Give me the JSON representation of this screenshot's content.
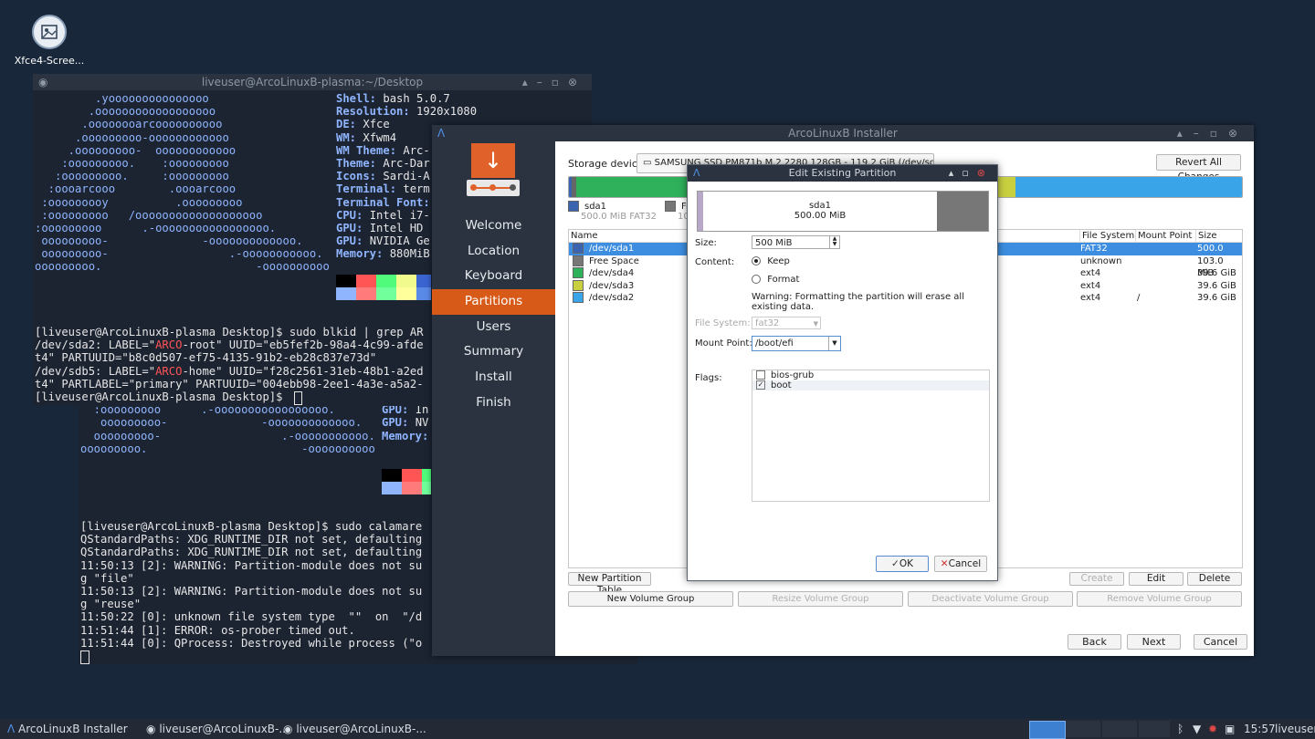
{
  "desktop": {
    "icon_label": "Xfce4-Scree..."
  },
  "terminal_front": {
    "title": "liveuser@ArcoLinuxB-plasma:~/Desktop",
    "logo": [
      "         .yooooooooooooooo",
      "        .oooooooooooooooooo",
      "       .oooooooarcoooooooooo",
      "      .ooooooooo-oooooooooooo",
      "     .ooooooooo-  oooooooooooo",
      "    :ooooooooo.    :ooooooooo",
      "   :ooooooooo.     :ooooooooo",
      "  :oooarcooo        .oooarcooo",
      " :ooooooooy          .ooooooooo",
      " :ooooooooo   /ooooooooooooooooooo",
      ":ooooooooo      .-ooooooooooooooooo.",
      " ooooooooo-              -ooooooooooooo.",
      " ooooooooo-                  .-ooooooooooo.",
      "ooooooooo.                       -oooooooooo"
    ],
    "info": [
      {
        "k": "Shell:",
        "v": " bash 5.0.7"
      },
      {
        "k": "Resolution:",
        "v": " 1920x1080"
      },
      {
        "k": "DE:",
        "v": " Xfce"
      },
      {
        "k": "WM:",
        "v": " Xfwm4"
      },
      {
        "k": "WM Theme:",
        "v": " Arc-"
      },
      {
        "k": "Theme:",
        "v": " Arc-Dar"
      },
      {
        "k": "Icons:",
        "v": " Sardi-A"
      },
      {
        "k": "Terminal:",
        "v": " term"
      },
      {
        "k": "Terminal Font:",
        "v": ""
      },
      {
        "k": "CPU:",
        "v": " Intel i7-"
      },
      {
        "k": "GPU:",
        "v": " Intel HD"
      },
      {
        "k": "GPU:",
        "v": " NVIDIA Ge"
      },
      {
        "k": "Memory:",
        "v": " 880MiB"
      }
    ],
    "cmd_lines": [
      "[liveuser@ArcoLinuxB-plasma Desktop]$ sudo blkid | grep AR",
      "/dev/sda2: LABEL=\"ARCO-root\" UUID=\"eb5fef2b-98a4-4c99-afde",
      "t4\" PARTUUID=\"b8c0d507-ef75-4135-91b2-eb28c837e73d\"",
      "/dev/sdb5: LABEL=\"ARCO-home\" UUID=\"f28c2561-31eb-48b1-a2ed",
      "t4\" PARTLABEL=\"primary\" PARTUUID=\"004ebb98-2ee1-4a3e-a5a2-",
      "[liveuser@ArcoLinuxB-plasma Desktop]$ "
    ]
  },
  "terminal_back": {
    "logo": [
      "   :ooooooooo   /ooooooooooooooooooo",
      "  :ooooooooo      .-ooooooooooooooooo.",
      "   ooooooooo-              -ooooooooooooo.",
      "  ooooooooo-                  .-ooooooooooo.",
      "ooooooooo.                       -oooooooooo"
    ],
    "info": [
      {
        "k": "CPU:",
        "v": " In"
      },
      {
        "k": "GPU:",
        "v": " In"
      },
      {
        "k": "GPU:",
        "v": " NV"
      },
      {
        "k": "Memory:",
        "v": ""
      }
    ],
    "cmd_lines": [
      "[liveuser@ArcoLinuxB-plasma Desktop]$ sudo calamare",
      "QStandardPaths: XDG_RUNTIME_DIR not set, defaulting",
      "QStandardPaths: XDG_RUNTIME_DIR not set, defaulting",
      "11:50:13 [2]: WARNING: Partition-module does not su",
      "g \"file\"",
      "11:50:13 [2]: WARNING: Partition-module does not su",
      "g \"reuse\"",
      "11:50:22 [0]: unknown file system type  \"\"  on  \"/d",
      "11:51:44 [1]: ERROR: os-prober timed out.",
      "11:51:44 [0]: QProcess: Destroyed while process (\"o"
    ]
  },
  "installer": {
    "title": "ArcoLinuxB Installer",
    "sidebar": [
      "Welcome",
      "Location",
      "Keyboard",
      "Partitions",
      "Users",
      "Summary",
      "Install",
      "Finish"
    ],
    "active_step": "Partitions",
    "storage_label": "Storage device:",
    "storage_value": "SAMSUNG SSD PM871b M.2 2280 128GB - 119.2 GiB (/dev/sda)",
    "revert_button": "Revert All Changes",
    "legend": [
      {
        "name": "sda1",
        "detail": "500.0 MiB  FAT32"
      },
      {
        "name": "Fre",
        "detail": "10"
      }
    ],
    "columns": {
      "name": "Name",
      "fs": "File System",
      "mount": "Mount Point",
      "size": "Size"
    },
    "rows": [
      {
        "name": "/dev/sda1",
        "fs": "FAT32",
        "mount": "",
        "size": "500.0 MiB",
        "color": "#3a64b0"
      },
      {
        "name": "Free Space",
        "fs": "unknown",
        "mount": "",
        "size": "103.0 MiB",
        "color": "#777777"
      },
      {
        "name": "/dev/sda4",
        "fs": "ext4",
        "mount": "",
        "size": "39.6 GiB",
        "color": "#2fb05a"
      },
      {
        "name": "/dev/sda3",
        "fs": "ext4",
        "mount": "",
        "size": "39.6 GiB",
        "color": "#c9d040"
      },
      {
        "name": "/dev/sda2",
        "fs": "ext4",
        "mount": "/",
        "size": "39.6 GiB",
        "color": "#3aa4e8"
      }
    ],
    "buttons": {
      "new_partition_table": "New Partition Table",
      "create": "Create",
      "edit": "Edit",
      "delete": "Delete",
      "new_volume_group": "New Volume Group",
      "resize_volume_group": "Resize Volume Group",
      "deactivate_volume_group": "Deactivate Volume Group",
      "remove_volume_group": "Remove Volume Group",
      "back": "Back",
      "next": "Next",
      "cancel": "Cancel"
    }
  },
  "dialog": {
    "title": "Edit Existing Partition",
    "preview_name": "sda1",
    "preview_size": "500.00 MiB",
    "size_label": "Size:",
    "size_value": "500 MiB",
    "content_label": "Content:",
    "keep_label": "Keep",
    "format_label": "Format",
    "warning": "Warning: Formatting the partition will erase all existing data.",
    "fs_label": "File System:",
    "fs_value": "fat32",
    "mount_label": "Mount Point:",
    "mount_value": "/boot/efi",
    "flags_label": "Flags:",
    "flags": [
      {
        "name": "bios-grub",
        "checked": false
      },
      {
        "name": "boot",
        "checked": true
      }
    ],
    "ok": "OK",
    "cancel": "Cancel"
  },
  "taskbar": {
    "items": [
      "ArcoLinuxB Installer",
      "liveuser@ArcoLinuxB-...",
      "liveuser@ArcoLinuxB-..."
    ],
    "clock": "15:57",
    "user": "liveuser"
  }
}
